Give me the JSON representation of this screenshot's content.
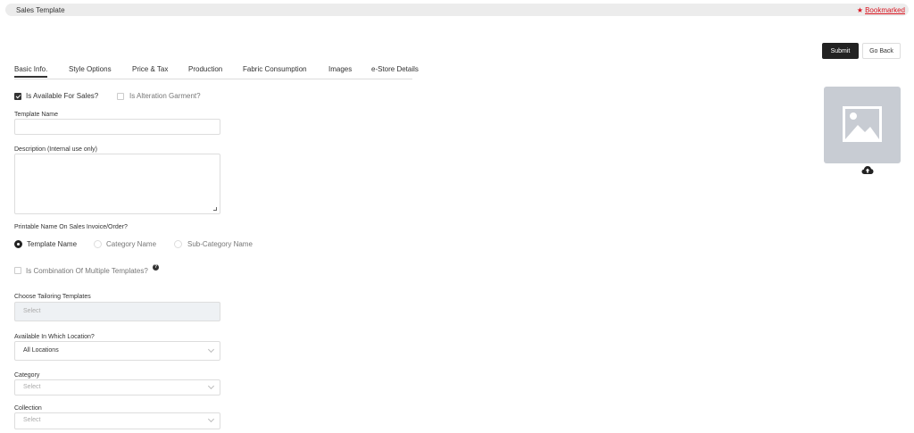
{
  "header": {
    "title": "Sales Template",
    "bookmark_star": "★",
    "bookmark_label": "Bookmarked",
    "accent_color": "#d9141f"
  },
  "actions": {
    "submit_label": "Submit",
    "back_label": "Go Back"
  },
  "tabs": [
    {
      "label": "Basic Info.",
      "active": true
    },
    {
      "label": "Style Options",
      "active": false
    },
    {
      "label": "Price & Tax",
      "active": false
    },
    {
      "label": "Production",
      "active": false
    },
    {
      "label": "Fabric Consumption",
      "active": false
    },
    {
      "label": "Images",
      "active": false
    },
    {
      "label": "e-Store Details",
      "active": false
    }
  ],
  "form": {
    "available_for_sales": {
      "label": "Is Available For Sales?",
      "checked": true
    },
    "alteration_garment": {
      "label": "Is Alteration Garment?",
      "checked": false
    },
    "template_name": {
      "label": "Template Name",
      "value": ""
    },
    "description": {
      "label": "Description (Internal use only)",
      "value": ""
    },
    "printable_name": {
      "label": "Printable Name On Sales Invoice/Order?",
      "options": [
        "Template Name",
        "Category Name",
        "Sub-Category Name"
      ],
      "selected": "Template Name"
    },
    "combination": {
      "label": "Is Combination Of Multiple Templates?",
      "checked": false,
      "help_glyph": "?"
    },
    "tailoring_templates": {
      "label": "Choose Tailoring Templates",
      "placeholder": "Select",
      "disabled": true
    },
    "location": {
      "label": "Available In Which Location?",
      "value": "All Locations"
    },
    "category": {
      "label": "Category",
      "placeholder": "Select"
    },
    "collection": {
      "label": "Collection",
      "placeholder": "Select"
    }
  },
  "image_panel": {
    "placeholder_icon": "image-placeholder-icon",
    "upload_icon": "cloud-upload-icon"
  }
}
